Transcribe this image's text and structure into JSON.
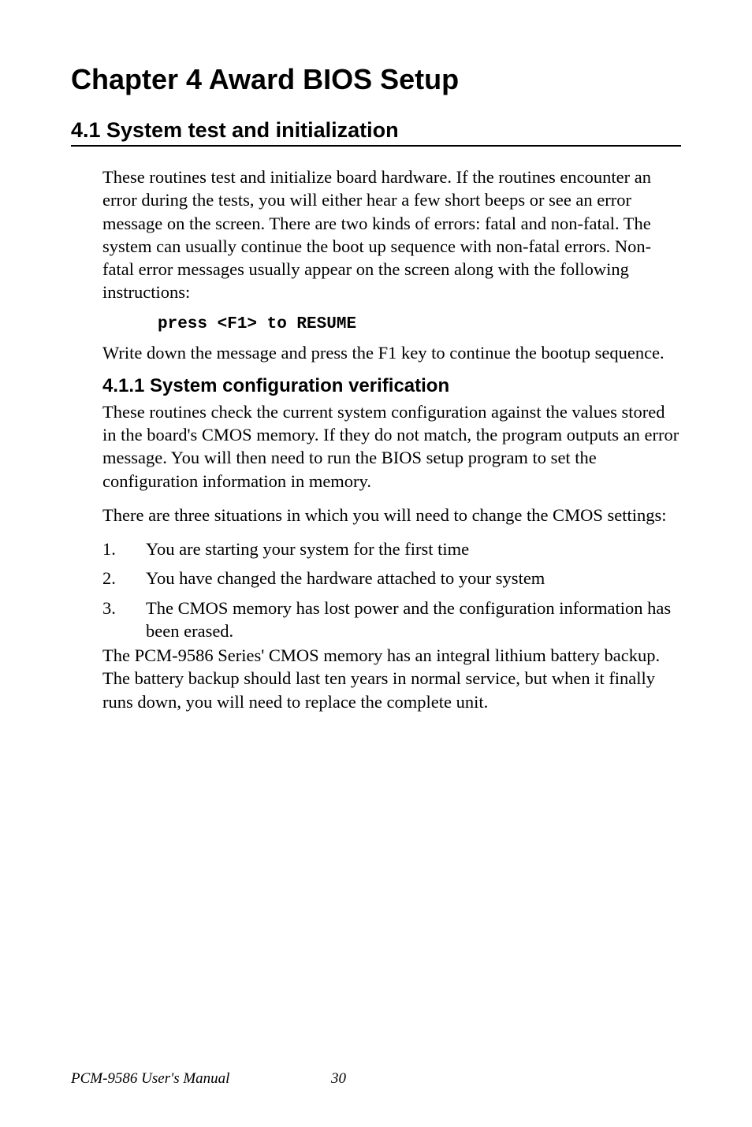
{
  "chapter": {
    "title": "Chapter 4  Award BIOS Setup"
  },
  "section": {
    "number_title": "4.1  System test and initialization"
  },
  "paragraphs": {
    "p1": "These routines test and initialize board hardware. If the routines encounter an error during the tests, you will either hear a few short beeps or see an error message on the screen. There are two kinds of errors: fatal and non-fatal. The system can usually continue the boot up sequence with non-fatal errors. Non-fatal error messages usually appear on the screen along with the following instructions:",
    "code": "press <F1> to RESUME",
    "p2": "Write down the message and press the F1 key to continue the bootup sequence."
  },
  "subsection": {
    "title": "4.1.1 System configuration verification",
    "p1": "These routines check the current system configuration against the values stored in the board's CMOS memory. If they do not match, the program outputs an error message. You will then need to run the BIOS setup program to set the configuration information in memory.",
    "p2": "There are three situations in which you will need to change the CMOS settings:",
    "items": [
      {
        "num": "1.",
        "text": "You are starting your system for the first time"
      },
      {
        "num": "2.",
        "text": "You have changed the hardware attached to your system"
      },
      {
        "num": "3.",
        "text": "The CMOS memory has lost power and the configuration information has been erased."
      }
    ],
    "p3": "The PCM-9586 Series' CMOS memory has an integral lithium battery backup. The battery backup should last ten years in normal service, but when it finally runs down, you will need to replace the complete unit."
  },
  "footer": {
    "manual": "PCM-9586 User's Manual",
    "page": "30"
  }
}
